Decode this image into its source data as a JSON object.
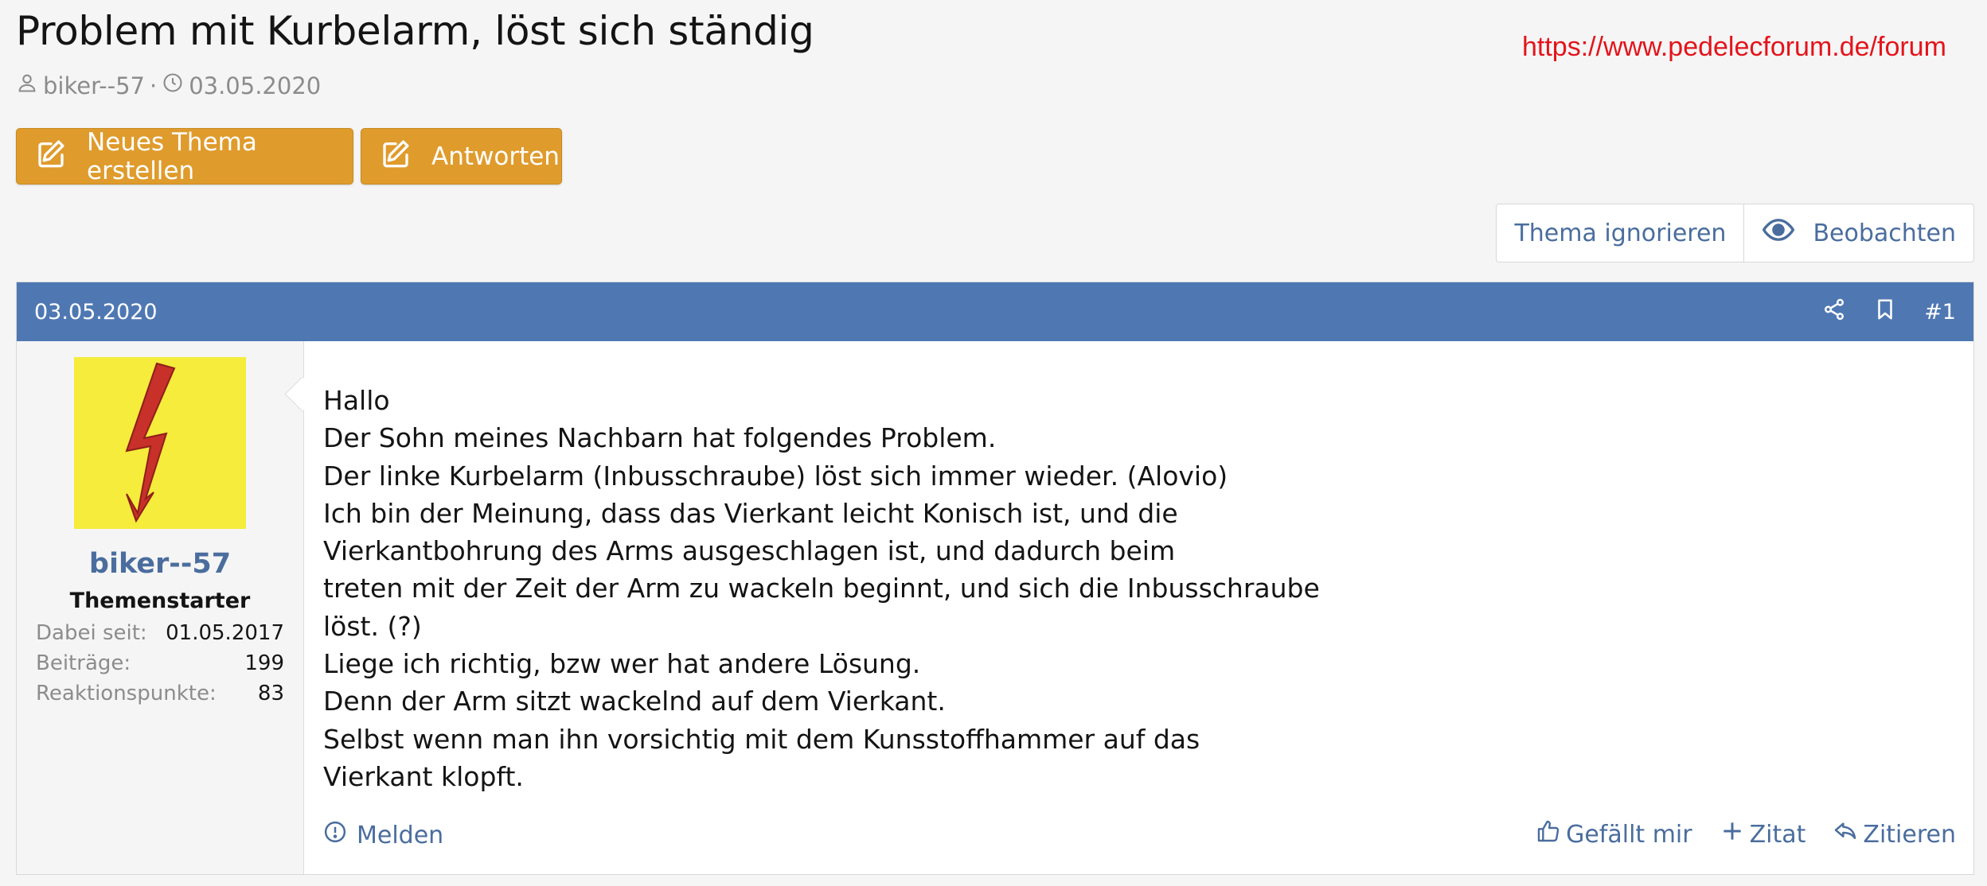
{
  "thread": {
    "title": "Problem mit Kurbelarm, löst sich ständig",
    "author": "biker--57",
    "separator": "·",
    "date": "03.05.2020"
  },
  "watermark": "https://www.pedelecforum.de/forum",
  "buttons": {
    "new_thread": "Neues Thema erstellen",
    "reply": "Antworten",
    "ignore": "Thema ignorieren",
    "watch": "Beobachten"
  },
  "post": {
    "date": "03.05.2020",
    "number": "#1",
    "user": {
      "name": "biker--57",
      "title": "Themenstarter",
      "stats": [
        {
          "label": "Dabei seit:",
          "value": "01.05.2017"
        },
        {
          "label": "Beiträge:",
          "value": "199"
        },
        {
          "label": "Reaktionspunkte:",
          "value": "83"
        }
      ]
    },
    "lines": [
      "Hallo",
      "Der Sohn meines Nachbarn hat folgendes Problem.",
      "Der linke Kurbelarm (Inbusschraube) löst sich immer wieder. (Alovio)",
      "Ich bin der Meinung, dass das Vierkant leicht Konisch ist, und die",
      "Vierkantbohrung des Arms ausgeschlagen ist, und dadurch beim",
      "treten mit der Zeit der Arm zu wackeln beginnt, und sich die Inbusschraube",
      "löst. (?)",
      "Liege ich richtig, bzw wer hat andere Lösung.",
      "Denn der Arm sitzt wackelnd auf dem Vierkant.",
      "Selbst wenn man ihn vorsichtig mit dem Kunsstoffhammer auf das",
      "Vierkant klopft."
    ],
    "actions": {
      "report": "Melden",
      "like": "Gefällt mir",
      "quote_add": "Zitat",
      "quote": "Zitieren"
    }
  },
  "colors": {
    "header": "#4f78b3",
    "button": "#df9b2c",
    "link": "#4a6d9e",
    "avatar_bg": "#f5ec3b",
    "bolt": "#c8302a"
  }
}
